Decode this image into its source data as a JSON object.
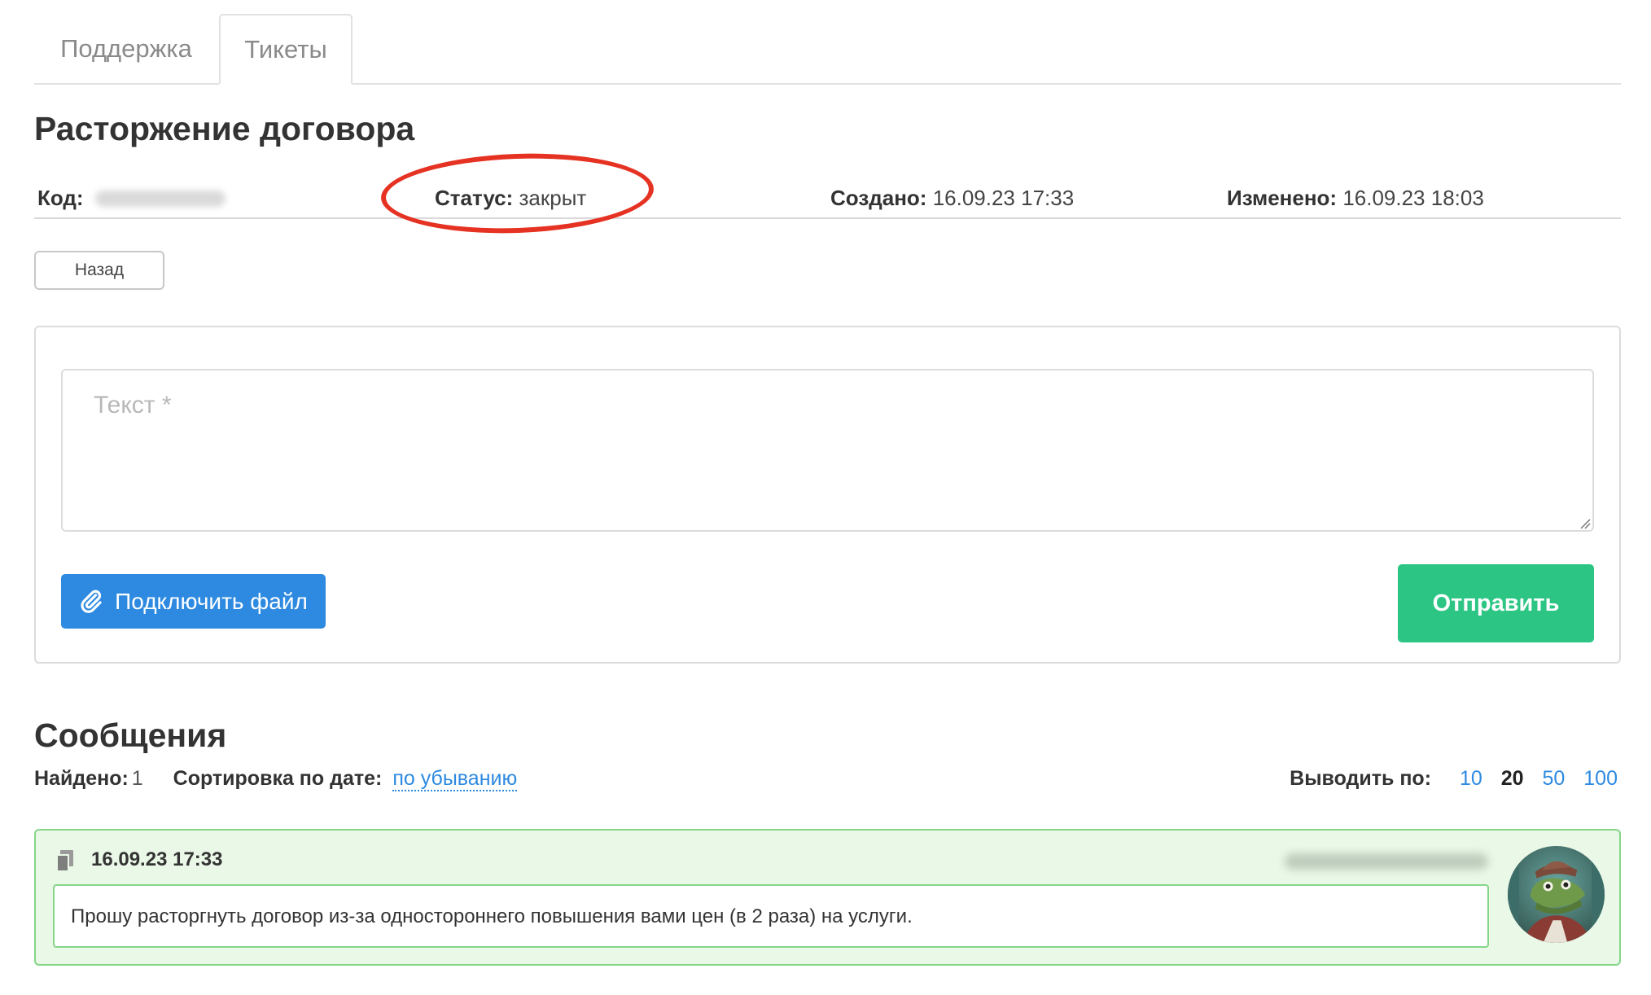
{
  "tabs": {
    "support": "Поддержка",
    "tickets": "Тикеты"
  },
  "ticket": {
    "title": "Расторжение договора",
    "code_label": "Код:",
    "status_label": "Статус:",
    "status_value": "закрыт",
    "created_label": "Создано:",
    "created_value": "16.09.23 17:33",
    "modified_label": "Изменено:",
    "modified_value": "16.09.23 18:03"
  },
  "back_button": "Назад",
  "form": {
    "text_placeholder": "Текст *",
    "attach_label": "Подключить файл",
    "send_label": "Отправить"
  },
  "messages": {
    "title": "Сообщения",
    "found_label": "Найдено:",
    "found_count": "1",
    "sort_label": "Сортировка по дате:",
    "sort_value": "по убыванию",
    "per_page_label": "Выводить по:",
    "per_page_options": [
      "10",
      "20",
      "50",
      "100"
    ],
    "per_page_selected": "20",
    "items": [
      {
        "date": "16.09.23 17:33",
        "text": "Прошу расторгнуть договор из-за одностороннего повышения вами цен (в 2 раза) на услуги."
      }
    ]
  },
  "colors": {
    "accent_blue": "#2e8ae0",
    "send_green": "#2cc584",
    "status_highlight": "#e53222",
    "message_bg": "#eaf8e8",
    "message_border": "#86d68a"
  },
  "icons": {
    "attach": "paperclip-icon",
    "message_type": "document-icon",
    "resize": "resize-handle-icon"
  }
}
